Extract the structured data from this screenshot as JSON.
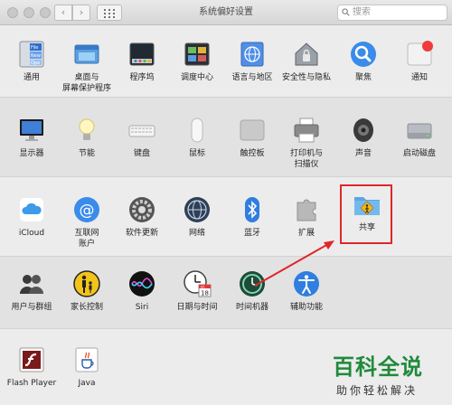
{
  "window": {
    "title": "系统偏好设置"
  },
  "toolbar": {
    "back": "‹",
    "forward": "›",
    "search_placeholder": "搜索"
  },
  "sections": [
    {
      "items": [
        {
          "id": "general",
          "label": "通用"
        },
        {
          "id": "desktop",
          "label": "桌面与\n屏幕保护程序"
        },
        {
          "id": "dock",
          "label": "程序坞"
        },
        {
          "id": "mission",
          "label": "调度中心"
        },
        {
          "id": "language",
          "label": "语言与地区"
        },
        {
          "id": "security",
          "label": "安全性与隐私"
        },
        {
          "id": "spotlight",
          "label": "聚焦"
        },
        {
          "id": "notifications",
          "label": "通知"
        }
      ]
    },
    {
      "items": [
        {
          "id": "displays",
          "label": "显示器"
        },
        {
          "id": "energy",
          "label": "节能"
        },
        {
          "id": "keyboard",
          "label": "键盘"
        },
        {
          "id": "mouse",
          "label": "鼠标"
        },
        {
          "id": "trackpad",
          "label": "触控板"
        },
        {
          "id": "printers",
          "label": "打印机与\n扫描仪"
        },
        {
          "id": "sound",
          "label": "声音"
        },
        {
          "id": "startup",
          "label": "启动磁盘"
        }
      ]
    },
    {
      "items": [
        {
          "id": "icloud",
          "label": "iCloud"
        },
        {
          "id": "internet",
          "label": "互联网\n账户"
        },
        {
          "id": "update",
          "label": "软件更新"
        },
        {
          "id": "network",
          "label": "网络"
        },
        {
          "id": "bluetooth",
          "label": "蓝牙"
        },
        {
          "id": "extensions",
          "label": "扩展"
        },
        {
          "id": "sharing",
          "label": "共享"
        }
      ]
    },
    {
      "items": [
        {
          "id": "users",
          "label": "用户与群组"
        },
        {
          "id": "parental",
          "label": "家长控制"
        },
        {
          "id": "siri",
          "label": "Siri"
        },
        {
          "id": "datetime",
          "label": "日期与时间"
        },
        {
          "id": "timemachine",
          "label": "时间机器"
        },
        {
          "id": "accessibility",
          "label": "辅助功能"
        }
      ]
    },
    {
      "items": [
        {
          "id": "flash",
          "label": "Flash Player"
        },
        {
          "id": "java",
          "label": "Java"
        }
      ]
    }
  ],
  "icons": {
    "general": "general-icon",
    "desktop": "desktop-icon",
    "dock": "dock-icon",
    "mission": "mission-control-icon",
    "language": "globe-flag-icon",
    "security": "house-lock-icon",
    "spotlight": "magnifier-icon",
    "notifications": "notification-badge-icon",
    "displays": "monitor-icon",
    "energy": "lightbulb-icon",
    "keyboard": "keyboard-icon",
    "mouse": "mouse-icon",
    "trackpad": "trackpad-icon",
    "printers": "printer-icon",
    "sound": "speaker-icon",
    "startup": "hard-drive-icon",
    "icloud": "cloud-icon",
    "internet": "at-sign-icon",
    "update": "gear-icon",
    "network": "globe-icon",
    "bluetooth": "bluetooth-icon",
    "extensions": "puzzle-icon",
    "sharing": "shared-folder-icon",
    "users": "users-icon",
    "parental": "parent-child-icon",
    "siri": "siri-icon",
    "datetime": "calendar-clock-icon",
    "timemachine": "time-machine-icon",
    "accessibility": "accessibility-icon",
    "flash": "flash-icon",
    "java": "java-cup-icon"
  },
  "calendar_day": "18",
  "calendar_month": "JUL",
  "general_icon_text": {
    "file": "File",
    "new": "New",
    "ope": "Ope"
  },
  "watermark": {
    "line1": "百科全说",
    "line2": "助你轻松解决"
  },
  "colors": {
    "highlight": "#e0262b",
    "watermark": "#1f8a3b"
  }
}
